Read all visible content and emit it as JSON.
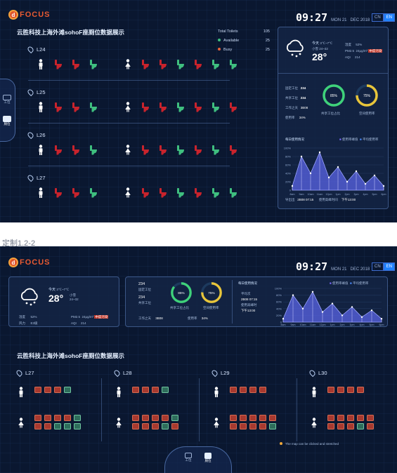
{
  "brand": {
    "logo_text": "FOCUS"
  },
  "clock": {
    "time": "09:27",
    "weekday": "MON 21",
    "date": "DEC 2018"
  },
  "lang": {
    "cn": "CN",
    "en": "EN"
  },
  "page_title": "云胜科技上海外滩sohoF座厕位数据展示",
  "caption": "定制1.2-2",
  "side_nav": [
    {
      "label": "工位"
    },
    {
      "label": "厕位"
    }
  ],
  "summary": {
    "total_label": "Total Toilets",
    "total": "105",
    "available_label": "Available",
    "available": "25",
    "busy_label": "Busy",
    "busy": "25"
  },
  "floors_v1": [
    {
      "name": "L24",
      "male": [
        "busy",
        "busy",
        "available"
      ],
      "female": [
        "busy",
        "busy",
        "available",
        "busy",
        "available",
        "available"
      ]
    },
    {
      "name": "L25",
      "male": [
        "busy",
        "busy",
        "available"
      ],
      "female": [
        "busy",
        "busy",
        "available",
        "busy",
        "available",
        "busy"
      ]
    },
    {
      "name": "L26",
      "male": [
        "busy",
        "busy",
        "available"
      ],
      "female": [
        "busy",
        "busy",
        "available",
        "busy",
        "available",
        "busy"
      ]
    },
    {
      "name": "L27",
      "male": [
        "busy",
        "busy",
        "available"
      ],
      "female": [
        "busy",
        "busy",
        "available",
        "busy",
        "available",
        "available"
      ]
    }
  ],
  "weather": {
    "day": "今天",
    "range": "3℃~7℃",
    "condition": "小雪",
    "aqi_range": "24~32",
    "temp": "28°",
    "humidity_label": "湿度",
    "humidity": "52%",
    "pm_label": "PM2.5",
    "pm": "24μg/m³",
    "aqi_label": "AQI",
    "aqi": "214",
    "aqi_badge": "中度污染",
    "wind_label": "风力",
    "wind": "E3级"
  },
  "stats": {
    "fixed_label": "固定工位",
    "fixed": "234",
    "shared_label": "共享工位",
    "shared": "234",
    "workday_label": "工作之天",
    "workday": "3B08",
    "usage_label": "使用率",
    "usage": "34%",
    "ring1_value": "85%",
    "ring1_label": "共享工位占比",
    "ring2_value": "75%",
    "ring2_label": "空间使用率",
    "record_label": "导出出",
    "record": "2B08 07:15",
    "peak_label": "使用高峰时间",
    "peak": "下午13:00",
    "peak_label2": "使用高峰时",
    "record_label2": "平均次"
  },
  "chart_data": {
    "type": "area",
    "title": "每日使用情况",
    "legend": [
      "使用率峰值",
      "平均使用率"
    ],
    "categories": [
      "8am",
      "9am",
      "10am",
      "11am",
      "12pm",
      "1pm",
      "2pm",
      "3pm",
      "4pm",
      "5pm",
      "6pm"
    ],
    "series": [
      {
        "name": "使用率峰值",
        "values": [
          10,
          80,
          40,
          90,
          30,
          55,
          20,
          45,
          15,
          35,
          10
        ]
      }
    ],
    "ylim": [
      0,
      100
    ],
    "yticks": [
      "100%",
      "80%",
      "60%",
      "40%",
      "20%",
      "0"
    ]
  },
  "floors_v2": [
    {
      "name": "L27",
      "male": [
        "busy",
        "busy",
        "busy",
        "available"
      ],
      "female": [
        "busy",
        "busy",
        "busy",
        "busy",
        "available",
        "busy",
        "busy",
        "available",
        "available",
        "available"
      ]
    },
    {
      "name": "L28",
      "male": [
        "busy",
        "busy",
        "busy",
        "available"
      ],
      "female": [
        "busy",
        "busy",
        "busy",
        "busy",
        "available",
        "busy",
        "busy",
        "busy",
        "available",
        "busy"
      ]
    },
    {
      "name": "L29",
      "male": [
        "busy",
        "busy",
        "busy",
        "busy"
      ],
      "female": [
        "busy",
        "busy",
        "busy",
        "busy",
        "busy",
        "busy",
        "busy",
        "busy",
        "busy",
        "available"
      ]
    },
    {
      "name": "L30",
      "male": [
        "busy",
        "busy",
        "busy",
        "busy"
      ],
      "female": [
        "busy",
        "busy",
        "busy",
        "busy",
        "busy",
        "busy",
        "busy",
        "busy",
        "available",
        "busy"
      ]
    }
  ],
  "footnote": "The map can be clicked and stretched",
  "bottom_nav": [
    {
      "label": "工位"
    },
    {
      "label": "厕位"
    }
  ],
  "colors": {
    "busy": "#c8232c",
    "available": "#3fbf7f",
    "ring1": "#3fd27a",
    "ring2": "#e8c53a",
    "accent": "#1f82ff"
  }
}
